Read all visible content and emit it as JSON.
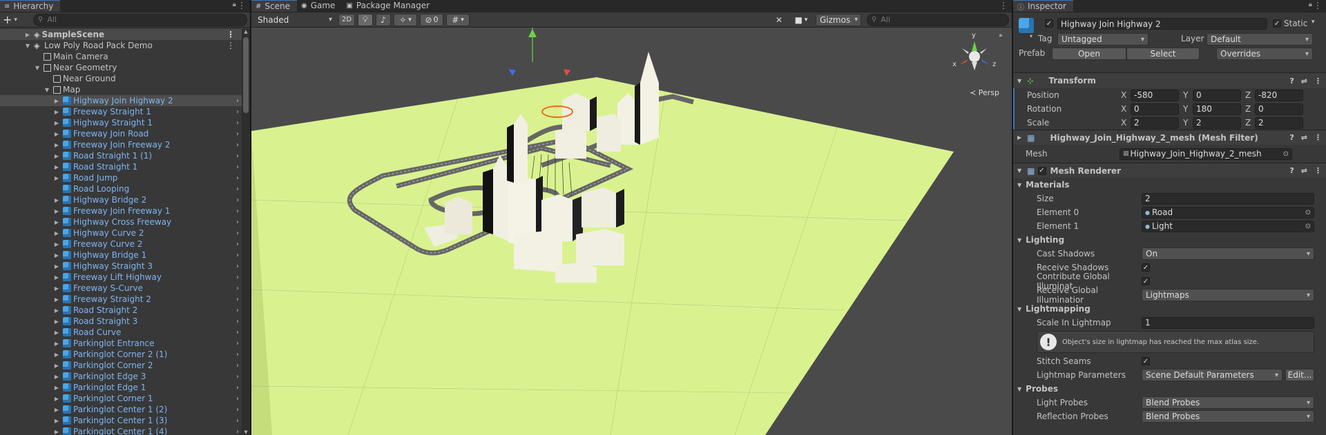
{
  "hierarchy": {
    "tab_label": "Hierarchy",
    "search_placeholder": "All",
    "add_label": "+",
    "scene": "SampleScene",
    "items": [
      {
        "label": "Low Poly Road Pack Demo",
        "indent": 1,
        "arrow": "▼",
        "icon": "scene",
        "kebab": true
      },
      {
        "label": "Main Camera",
        "indent": 2,
        "arrow": "",
        "icon": "cube"
      },
      {
        "label": "Near Geometry",
        "indent": 2,
        "arrow": "▼",
        "icon": "cube"
      },
      {
        "label": "Near Ground",
        "indent": 3,
        "arrow": "",
        "icon": "cube"
      },
      {
        "label": "Map",
        "indent": 3,
        "arrow": "▼",
        "icon": "cube"
      },
      {
        "label": "Highway Join Highway 2",
        "indent": 4,
        "arrow": "▶",
        "icon": "prefab",
        "selected": true
      },
      {
        "label": "Freeway Straight 1",
        "indent": 4,
        "arrow": "▶",
        "icon": "prefab"
      },
      {
        "label": "Highway Straight 1",
        "indent": 4,
        "arrow": "▶",
        "icon": "prefab"
      },
      {
        "label": "Freeway Join Road",
        "indent": 4,
        "arrow": "▶",
        "icon": "prefab"
      },
      {
        "label": "Freeway Join Freeway 2",
        "indent": 4,
        "arrow": "▶",
        "icon": "prefab"
      },
      {
        "label": "Road Straight 1 (1)",
        "indent": 4,
        "arrow": "▶",
        "icon": "prefab"
      },
      {
        "label": "Road Straight 1",
        "indent": 4,
        "arrow": "▶",
        "icon": "prefab"
      },
      {
        "label": "Road Jump",
        "indent": 4,
        "arrow": "▶",
        "icon": "prefab"
      },
      {
        "label": "Road Looping",
        "indent": 4,
        "arrow": "",
        "icon": "prefab"
      },
      {
        "label": "Highway Bridge 2",
        "indent": 4,
        "arrow": "▶",
        "icon": "prefab"
      },
      {
        "label": "Freeway Join Freeway 1",
        "indent": 4,
        "arrow": "▶",
        "icon": "prefab"
      },
      {
        "label": "Highway Cross Freeway",
        "indent": 4,
        "arrow": "▶",
        "icon": "prefab"
      },
      {
        "label": "Highway Curve 2",
        "indent": 4,
        "arrow": "▶",
        "icon": "prefab"
      },
      {
        "label": "Freeway Curve 2",
        "indent": 4,
        "arrow": "▶",
        "icon": "prefab"
      },
      {
        "label": "Highway Bridge 1",
        "indent": 4,
        "arrow": "▶",
        "icon": "prefab"
      },
      {
        "label": "Highway Straight 3",
        "indent": 4,
        "arrow": "▶",
        "icon": "prefab"
      },
      {
        "label": "Freeway Lift Highway",
        "indent": 4,
        "arrow": "▶",
        "icon": "prefab"
      },
      {
        "label": "Freeway S-Curve",
        "indent": 4,
        "arrow": "▶",
        "icon": "prefab"
      },
      {
        "label": "Freeway Straight 2",
        "indent": 4,
        "arrow": "▶",
        "icon": "prefab"
      },
      {
        "label": "Road Straight 2",
        "indent": 4,
        "arrow": "▶",
        "icon": "prefab"
      },
      {
        "label": "Road Straight 3",
        "indent": 4,
        "arrow": "▶",
        "icon": "prefab"
      },
      {
        "label": "Road Curve",
        "indent": 4,
        "arrow": "▶",
        "icon": "prefab"
      },
      {
        "label": "Parkinglot Entrance",
        "indent": 4,
        "arrow": "▶",
        "icon": "prefab"
      },
      {
        "label": "Parkinglot Corner 2 (1)",
        "indent": 4,
        "arrow": "▶",
        "icon": "prefab"
      },
      {
        "label": "Parkinglot Corner 2",
        "indent": 4,
        "arrow": "▶",
        "icon": "prefab"
      },
      {
        "label": "Parkinglot Edge 3",
        "indent": 4,
        "arrow": "▶",
        "icon": "prefab"
      },
      {
        "label": "Parkinglot Edge 1",
        "indent": 4,
        "arrow": "▶",
        "icon": "prefab"
      },
      {
        "label": "Parkinglot Corner 1",
        "indent": 4,
        "arrow": "▶",
        "icon": "prefab"
      },
      {
        "label": "Parkinglot Center 1 (2)",
        "indent": 4,
        "arrow": "▶",
        "icon": "prefab"
      },
      {
        "label": "Parkinglot Center 1 (3)",
        "indent": 4,
        "arrow": "▶",
        "icon": "prefab"
      },
      {
        "label": "Parkinglot Center 1 (4)",
        "indent": 4,
        "arrow": "▶",
        "icon": "prefab"
      }
    ]
  },
  "scene_view": {
    "tabs": [
      "Scene",
      "Game",
      "Package Manager"
    ],
    "shading": "Shaded",
    "mode_2d": "2D",
    "hidden_count": "0",
    "gizmos": "Gizmos",
    "search_placeholder": "All",
    "persp": "Persp",
    "axis_x": "x",
    "axis_y": "y",
    "axis_z": "z"
  },
  "inspector": {
    "tab_label": "Inspector",
    "object_name": "Highway Join Highway 2",
    "static_label": "Static",
    "tag_label": "Tag",
    "tag_value": "Untagged",
    "layer_label": "Layer",
    "layer_value": "Default",
    "prefab_label": "Prefab",
    "prefab_open": "Open",
    "prefab_select": "Select",
    "prefab_overrides": "Overrides",
    "transform": {
      "title": "Transform",
      "position_label": "Position",
      "rotation_label": "Rotation",
      "scale_label": "Scale",
      "position": [
        "-580",
        "0",
        "-820"
      ],
      "rotation": [
        "0",
        "180",
        "0"
      ],
      "scale": [
        "2",
        "2",
        "2"
      ]
    },
    "mesh_filter": {
      "title": "Highway_Join_Highway_2_mesh (Mesh Filter)",
      "mesh_label": "Mesh",
      "mesh_value": "Highway_Join_Highway_2_mesh"
    },
    "mesh_renderer": {
      "title": "Mesh Renderer",
      "materials_label": "Materials",
      "size_label": "Size",
      "size_value": "2",
      "element0_label": "Element 0",
      "element0_value": "Road",
      "element1_label": "Element 1",
      "element1_value": "Light",
      "lighting_label": "Lighting",
      "cast_shadows_label": "Cast Shadows",
      "cast_shadows_value": "On",
      "receive_shadows_label": "Receive Shadows",
      "contribute_gi_label": "Contribute Global Illuminat",
      "receive_gi_label": "Receive Global Illuminatior",
      "receive_gi_value": "Lightmaps",
      "lightmapping_label": "Lightmapping",
      "scale_lightmap_label": "Scale In Lightmap",
      "scale_lightmap_value": "1",
      "warning": "Object's size in lightmap has reached the max atlas size.",
      "stitch_label": "Stitch Seams",
      "lightmap_params_label": "Lightmap Parameters",
      "lightmap_params_value": "Scene Default Parameters",
      "edit_label": "Edit...",
      "probes_label": "Probes",
      "light_probes_label": "Light Probes",
      "light_probes_value": "Blend Probes",
      "reflection_probes_label": "Reflection Probes",
      "reflection_probes_value": "Blend Probes"
    }
  }
}
